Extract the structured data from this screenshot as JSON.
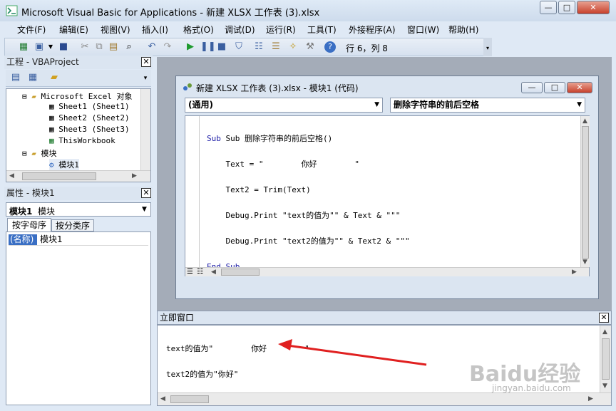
{
  "window": {
    "title": "Microsoft Visual Basic for Applications - 新建 XLSX 工作表 (3).xlsx"
  },
  "menu": [
    "文件(F)",
    "编辑(E)",
    "视图(V)",
    "插入(I)",
    "格式(O)",
    "调试(D)",
    "运行(R)",
    "工具(T)",
    "外接程序(A)",
    "窗口(W)",
    "帮助(H)"
  ],
  "toolbar": {
    "position": "行 6，列 8"
  },
  "project": {
    "title": "工程 - VBAProject",
    "items": [
      "Microsoft Excel 对象",
      "Sheet1 (Sheet1)",
      "Sheet2 (Sheet2)",
      "Sheet3 (Sheet3)",
      "ThisWorkbook",
      "模块",
      "模块1"
    ]
  },
  "properties": {
    "title": "属性 - 模块1",
    "object_name": "模块1",
    "object_type": "模块",
    "tab_alpha": "按字母序",
    "tab_category": "按分类序",
    "prop_name": "(名称)",
    "prop_value": "模块1"
  },
  "code_window": {
    "title": "新建 XLSX 工作表 (3).xlsx - 模块1 (代码)",
    "object_combo": "(通用)",
    "proc_combo": "删除字符串的前后空格",
    "lines": [
      "Sub 删除字符串的前后空格()",
      "    Text = \"        你好        \"",
      "    Text2 = Trim(Text)",
      "    Debug.Print \"text的值为\"\" & Text & \"\"\"",
      "    Debug.Print \"text2的值为\"\" & Text2 & \"\"\"",
      "End Sub"
    ]
  },
  "immediate": {
    "title": "立即窗口",
    "lines": [
      "text的值为\"        你好        \"",
      "text2的值为\"你好\""
    ]
  },
  "watermark": {
    "brand": "Baidu经验",
    "url": "jingyan.baidu.com"
  },
  "colors": {
    "accent": "#dbe5f1",
    "arrow": "#e02020",
    "selection": "#3a6fc4"
  }
}
